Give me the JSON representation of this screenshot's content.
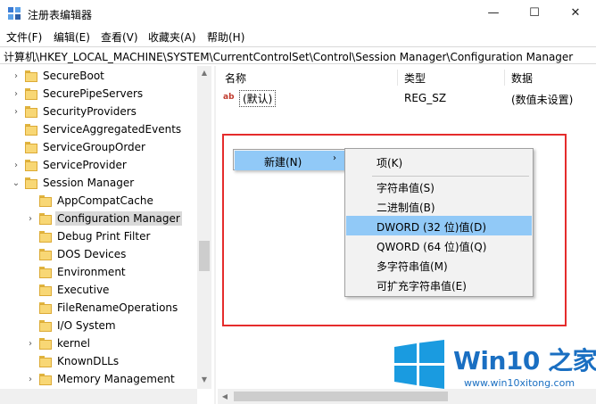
{
  "window": {
    "title": "注册表编辑器",
    "minimize": "—",
    "maximize": "☐",
    "close": "✕"
  },
  "menu": [
    "文件(F)",
    "编辑(E)",
    "查看(V)",
    "收藏夹(A)",
    "帮助(H)"
  ],
  "address": "计算机\\HKEY_LOCAL_MACHINE\\SYSTEM\\CurrentControlSet\\Control\\Session Manager\\Configuration Manager",
  "tree": {
    "items": [
      {
        "label": "SecureBoot",
        "level": 0,
        "expandable": true,
        "expanded": false,
        "selected": false
      },
      {
        "label": "SecurePipeServers",
        "level": 0,
        "expandable": true,
        "expanded": false,
        "selected": false
      },
      {
        "label": "SecurityProviders",
        "level": 0,
        "expandable": true,
        "expanded": false,
        "selected": false
      },
      {
        "label": "ServiceAggregatedEvents",
        "level": 0,
        "expandable": false,
        "expanded": false,
        "selected": false
      },
      {
        "label": "ServiceGroupOrder",
        "level": 0,
        "expandable": false,
        "expanded": false,
        "selected": false
      },
      {
        "label": "ServiceProvider",
        "level": 0,
        "expandable": true,
        "expanded": false,
        "selected": false
      },
      {
        "label": "Session Manager",
        "level": 0,
        "expandable": true,
        "expanded": true,
        "selected": false
      },
      {
        "label": "AppCompatCache",
        "level": 1,
        "expandable": false,
        "expanded": false,
        "selected": false
      },
      {
        "label": "Configuration Manager",
        "level": 1,
        "expandable": true,
        "expanded": false,
        "selected": true
      },
      {
        "label": "Debug Print Filter",
        "level": 1,
        "expandable": false,
        "expanded": false,
        "selected": false
      },
      {
        "label": "DOS Devices",
        "level": 1,
        "expandable": false,
        "expanded": false,
        "selected": false
      },
      {
        "label": "Environment",
        "level": 1,
        "expandable": false,
        "expanded": false,
        "selected": false
      },
      {
        "label": "Executive",
        "level": 1,
        "expandable": false,
        "expanded": false,
        "selected": false
      },
      {
        "label": "FileRenameOperations",
        "level": 1,
        "expandable": false,
        "expanded": false,
        "selected": false
      },
      {
        "label": "I/O System",
        "level": 1,
        "expandable": false,
        "expanded": false,
        "selected": false
      },
      {
        "label": "kernel",
        "level": 1,
        "expandable": true,
        "expanded": false,
        "selected": false
      },
      {
        "label": "KnownDLLs",
        "level": 1,
        "expandable": false,
        "expanded": false,
        "selected": false
      },
      {
        "label": "Memory Management",
        "level": 1,
        "expandable": true,
        "expanded": false,
        "selected": false
      }
    ]
  },
  "columns": {
    "name": "名称",
    "type": "类型",
    "data": "数据"
  },
  "values": [
    {
      "icon": "ab",
      "name": "(默认)",
      "type": "REG_SZ",
      "data": "(数值未设置)"
    }
  ],
  "context_menu": {
    "new_label": "新建(N)",
    "submenu_arrow": "›",
    "submenu": {
      "key": "项(K)",
      "items": [
        "字符串值(S)",
        "二进制值(B)",
        "DWORD (32 位)值(D)",
        "QWORD (64 位)值(Q)",
        "多字符串值(M)",
        "可扩充字符串值(E)"
      ],
      "hover_index": 2
    }
  },
  "watermark": {
    "brand": "Win10 之家",
    "url": "www.win10xitong.com"
  },
  "colors": {
    "highlight_border": "#e52c2c",
    "menu_hover": "#91c9f7",
    "folder": "#f8d775",
    "brand_blue": "#1a6fc2"
  }
}
